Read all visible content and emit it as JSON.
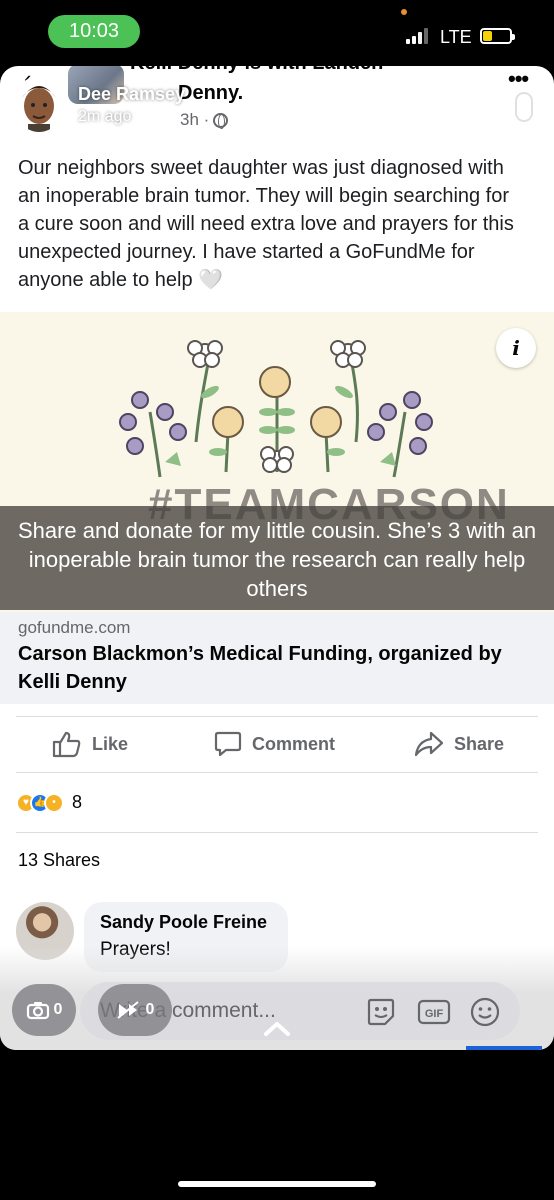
{
  "status_bar": {
    "time": "10:03",
    "carrier": "LTE"
  },
  "post": {
    "header_line1": "Kelli Denny is with Landen",
    "header_line2": "Denny.",
    "time_ago": "3h ·",
    "text": "Our neighbors sweet daughter was just diagnosed with an inoperable brain tumor. They will begin searching for a cure soon and will need extra love and prayers for this unexpected journey. I have started a GoFundMe for anyone able to help 🤍",
    "image_overlay_text": "#TEAMCARSON",
    "link": {
      "domain": "gofundme.com",
      "title": "Carson Blackmon’s Medical Funding, organized by Kelli Denny"
    },
    "actions": {
      "like": "Like",
      "comment": "Comment",
      "share": "Share"
    },
    "reaction_count": "8",
    "shares": "13 Shares",
    "comments": [
      {
        "author": "Sandy Poole Freine",
        "text": "Prayers!"
      }
    ],
    "comment_placeholder": "Write a comment..."
  },
  "snap": {
    "sender_name": "Dee Ramsey",
    "sender_time": "2m ago",
    "caption": "Share and donate for my little cousin. She’s 3 with an inoperable brain tumor the research can really help others",
    "view_count": "0",
    "replay_count": "0"
  },
  "icons": [
    "back-chevron-icon",
    "more-icon",
    "globe-icon",
    "info-icon",
    "like-icon",
    "comment-icon",
    "share-icon",
    "camera-icon",
    "sticker-icon",
    "gif-icon",
    "emoji-icon",
    "chevron-up-icon"
  ],
  "colors": {
    "facebook_blue": "#1b64d8",
    "muted_text": "#65676b",
    "status_pill": "#4cc155"
  }
}
